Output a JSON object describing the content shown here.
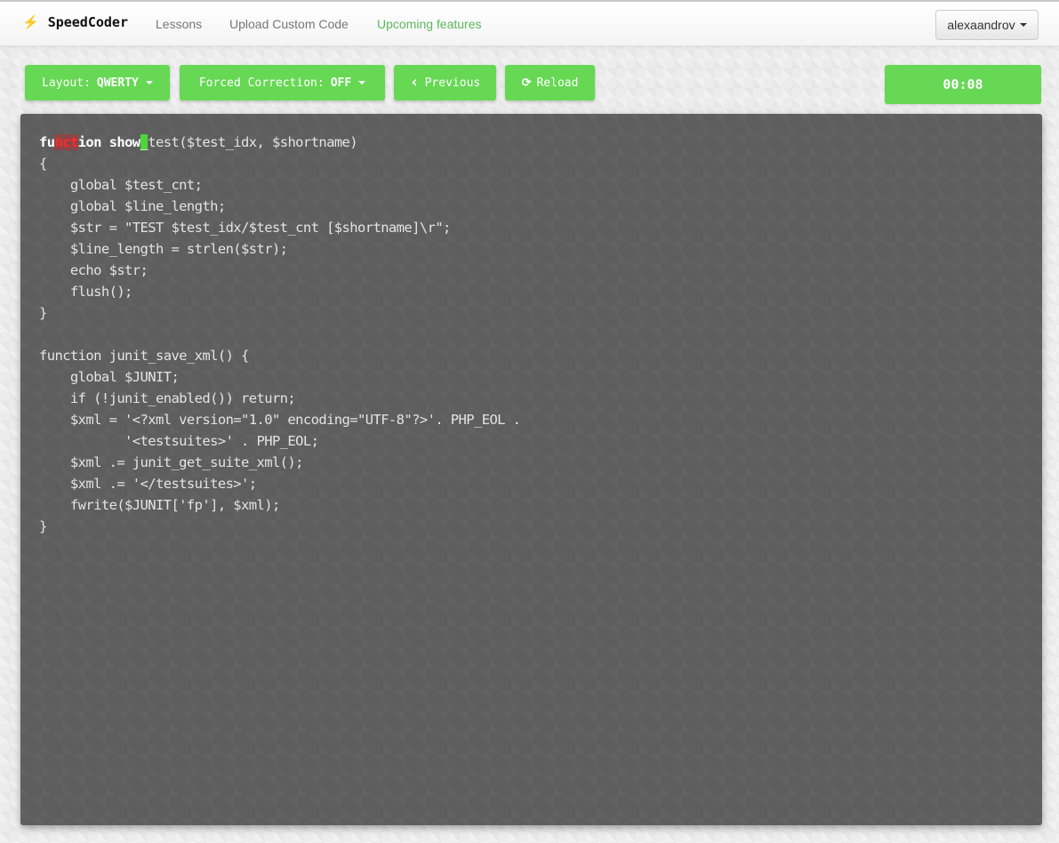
{
  "navbar": {
    "brand_icon": "lightning-bolt-icon",
    "brand_glyph": "⚡",
    "brand": "SpeedCoder",
    "links": [
      "Lessons",
      "Upload Custom Code",
      "Upcoming features"
    ],
    "highlight_color": "#5cb85c",
    "user": "alexaandrov"
  },
  "toolbar": {
    "layout_label": "Layout:",
    "layout_value": "QWERTY",
    "correction_label": "Forced Correction:",
    "correction_value": "OFF",
    "previous_label": "Previous",
    "previous_icon": "‹",
    "reload_label": "Reload",
    "reload_icon": "⟳",
    "accent_color": "#66d854"
  },
  "timer": "00:08",
  "code": {
    "typed_correct_1": "fu",
    "typed_errors": "nct",
    "typed_correct_2": "ion show",
    "cursor_char": "_",
    "first_line_rest": "test($test_idx, $shortname)",
    "remaining_lines": "{\n    global $test_cnt;\n    global $line_length;\n    $str = \"TEST $test_idx/$test_cnt [$shortname]\\r\";\n    $line_length = strlen($str);\n    echo $str;\n    flush();\n}\n\nfunction junit_save_xml() {\n    global $JUNIT;\n    if (!junit_enabled()) return;\n    $xml = '<?xml version=\"1.0\" encoding=\"UTF-8\"?>'. PHP_EOL .\n           '<testsuites>' . PHP_EOL;\n    $xml .= junit_get_suite_xml();\n    $xml .= '</testsuites>';\n    fwrite($JUNIT['fp'], $xml);\n}"
  }
}
